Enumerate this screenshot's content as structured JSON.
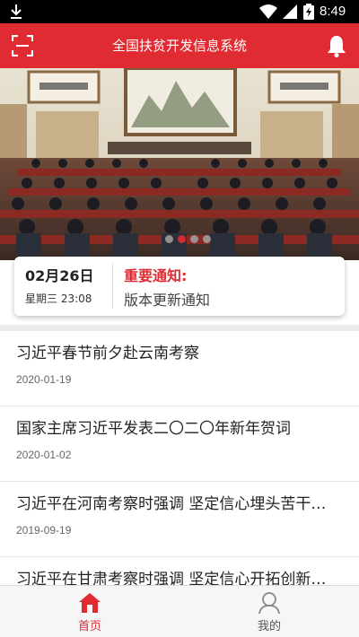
{
  "status_bar": {
    "time": "8:49"
  },
  "header": {
    "title": "全国扶贫开发信息系统"
  },
  "banner": {
    "slide_count": 4,
    "active_slide": 2
  },
  "notice": {
    "date": "02月26日",
    "weekday_time": "星期三 23:08",
    "title": "重要通知:",
    "text": "版本更新通知"
  },
  "news": [
    {
      "title": "习近平春节前夕赴云南考察",
      "date": "2020-01-19"
    },
    {
      "title": "国家主席习近平发表二〇二〇年新年贺词",
      "date": "2020-01-02"
    },
    {
      "title": "习近平在河南考察时强调 坚定信心埋头苦干…",
      "date": "2019-09-19"
    },
    {
      "title": "习近平在甘肃考察时强调 坚定信心开拓创新…",
      "date": ""
    }
  ],
  "tabs": [
    {
      "label": "首页",
      "icon": "home-icon",
      "active": true
    },
    {
      "label": "我的",
      "icon": "user-icon",
      "active": false
    }
  ],
  "colors": {
    "accent": "#e02b32",
    "status_bar": "#000000"
  }
}
